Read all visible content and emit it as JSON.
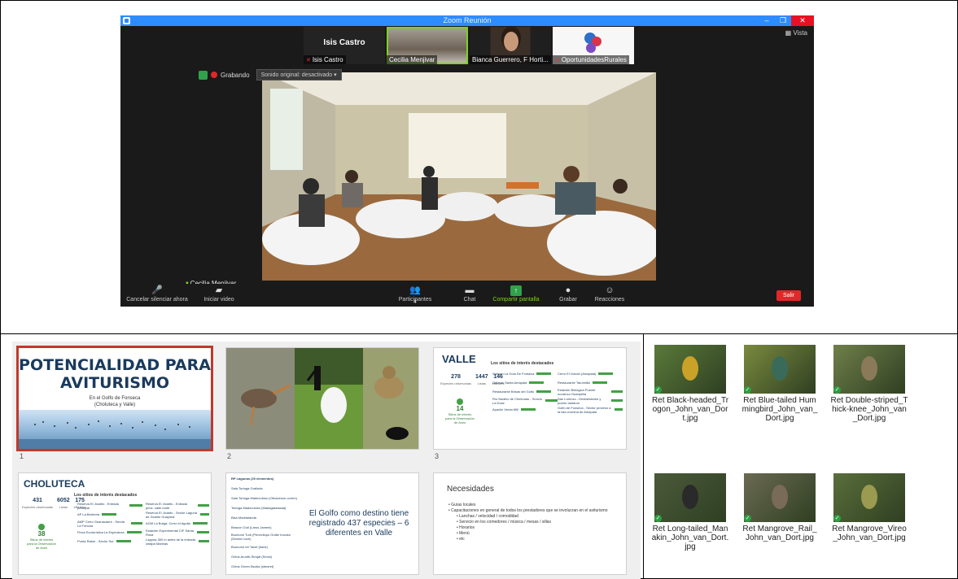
{
  "zoom": {
    "window_title": "Zoom Reunión",
    "view_label": "Vista",
    "gallery": [
      {
        "label": "Isis Castro",
        "big": "Isis Castro"
      },
      {
        "label": "Cecilia Menjivar"
      },
      {
        "label": "Bianca Guerrero, F Horti..."
      },
      {
        "label": "OportunidadesRurales"
      }
    ],
    "recording_label": "Grabando",
    "sound_button": "Sonido original: desactivado",
    "active_speaker": "Cecilia Menjivar",
    "toolbar": {
      "mute": "Cancelar silenciar ahora",
      "video": "Iniciar video",
      "participants": "Participantes",
      "participants_count": "4",
      "chat": "Chat",
      "share": "Compartir pantalla",
      "record": "Grabar",
      "reactions": "Reacciones",
      "leave": "Salir"
    }
  },
  "slides": {
    "numbers": [
      "1",
      "2",
      "3"
    ],
    "s1": {
      "title_line1": "POTENCIALIDAD PARA",
      "title_line2": "AVITURISMO",
      "sub1": "En el Golfo de Fonseca",
      "sub2": "(Choluteca y Valle)"
    },
    "s3": {
      "title": "VALLE",
      "subtitle": "Los sitios de interés destacados",
      "stats": [
        {
          "v": "278",
          "l": "Especies observadas"
        },
        {
          "v": "1447",
          "l": "Listas"
        },
        {
          "v": "146",
          "l": "eBirders"
        }
      ],
      "green_value": "14",
      "green_label": "Sitios de interés para la Observación de Aves",
      "sites": [
        "Sahsen La Gola De Fonseca",
        "Galeras Santa Amapala",
        "Restaurante Brisas del Golfo",
        "Río Nadero de Chintonas - Soncio La Dose",
        "Apaxilo Verda Mill",
        "Cerro El Volcán (Amapala)",
        "Restaurante Tarumillia",
        "Estación Biológica Puente ocosinco Guaripella",
        "San Lorenzo - Desfaeratorio y puerto Iantaron",
        "Golfo de Fonseca - Sector próximo a la Isla cromina de Amapala"
      ]
    },
    "s4": {
      "title": "CHOLUTECA",
      "subtitle": "Los sitios de interés destacados",
      "stats": [
        {
          "v": "431",
          "l": "Especies observadas"
        },
        {
          "v": "6052",
          "l": "Listas"
        },
        {
          "v": "175",
          "l": "eBirders"
        }
      ],
      "green_value": "38",
      "green_label": "Sitios de interés para la Observación de Aves",
      "sites": [
        "Reserva El Jicarito - Entrada principal",
        "AP La Berberia",
        "AMP Cerro Guanacaure - Senda La Fortuna",
        "Finca Ecoturística La Esperanza",
        "Punta Ratón - Sector Sur",
        "Reserva El Jicarito - Entrada princ. calle norte",
        "Reserva El Jicarito - Sector Laguna de Jicarito Guaymal",
        "AGM La Bulga- Cerro el Aguila",
        "Estación Experimental CIF Santa Rosa",
        "Laguna 350 m antes de la entrada Iztalpa Marinas"
      ]
    },
    "s5": {
      "side_title": "RP Lagunas (20 elementos)",
      "side_items": [
        "Sala Tortuga Gralinda",
        "Sala Tortuga Madeculoso (Olivaceous ocrem)",
        "Tortuga Madeculoso (Madagaseaaaa)",
        "Bisa Madrialanda",
        "Beacon Gull (Larus Jameni)",
        "Buonorol Turk (Penecilopo Gutbe bucsko (Divinim tuch)",
        "Buonorol ret Taxet (bank)",
        "Gritos Aruntb-Strojat (Sensi)",
        "Gritos Green Bsoba (sbesret)"
      ],
      "main_text": "El Golfo como destino tiene registrado 437 especies – 6 diferentes en Valle"
    },
    "s6": {
      "title": "Necesidades",
      "items": [
        {
          "t": "Guías locales",
          "sub": false
        },
        {
          "t": "Capacitaciones en general de todos los prestadores que se involucran en el aviturismo",
          "sub": false
        },
        {
          "t": "Lanchas / velocidad / comodidad",
          "sub": true
        },
        {
          "t": "Servicio en los comedores / música / mesas / sillas",
          "sub": true
        },
        {
          "t": "Horarios",
          "sub": true
        },
        {
          "t": "Menú",
          "sub": true
        },
        {
          "t": "etc",
          "sub": true
        }
      ]
    }
  },
  "files": [
    {
      "name": "Ret Black-headed_Trogon_John_van_Dort.jpg",
      "bg": "#5a7a3a",
      "bird": "#c9a227"
    },
    {
      "name": "Ret Blue-tailed Hummingbird_John_van_Dort.jpg",
      "bg": "#7a8a3e",
      "bird": "#3a6b5a"
    },
    {
      "name": "Ret Double-striped_Thick-knee_John_van_Dort.jpg",
      "bg": "#6f7f4a",
      "bird": "#8a7a5a"
    },
    {
      "name": "Ret Long-tailed_Manakin_John_van_Dort.jpg",
      "bg": "#4a5a3a",
      "bird": "#2a2a2a"
    },
    {
      "name": "Ret Mangrove_Rail_John_van_Dort.jpg",
      "bg": "#6a6a52",
      "bird": "#7a6a58"
    },
    {
      "name": "Ret Mangrove_Vireo_John_van_Dort.jpg",
      "bg": "#5a6e3a",
      "bird": "#9a9a50"
    }
  ]
}
